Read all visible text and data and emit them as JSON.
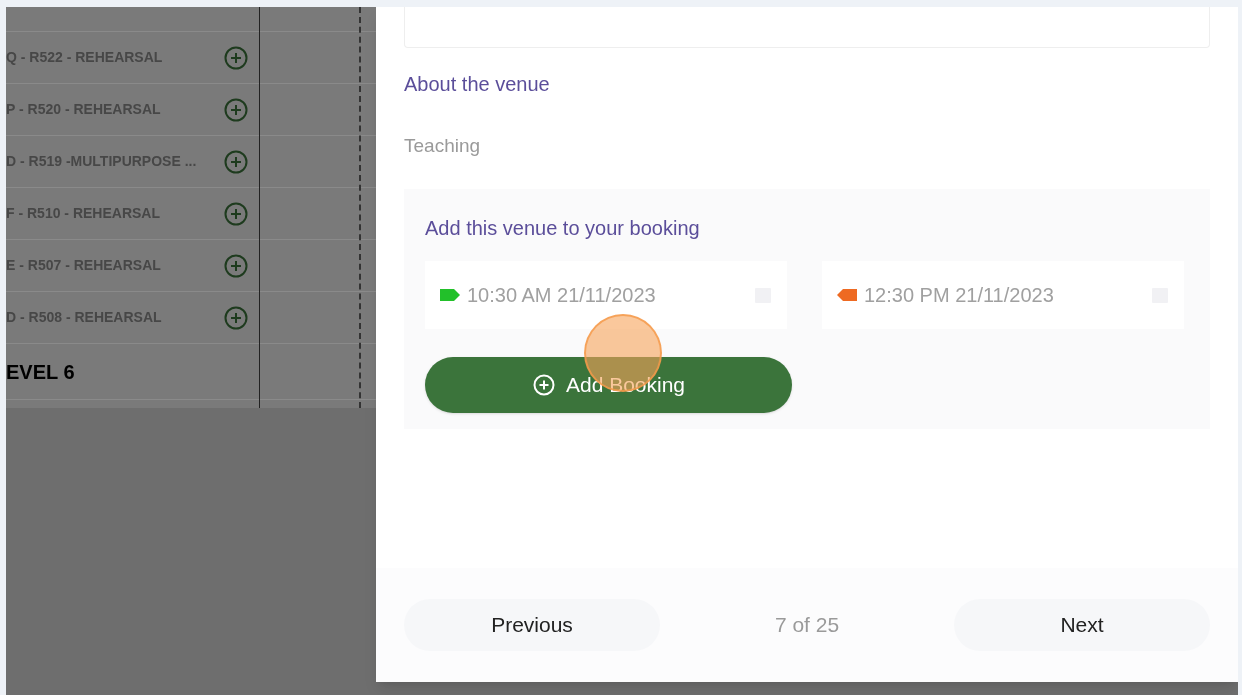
{
  "venue_list": {
    "rows": [
      {
        "label": "Q - R522 - REHEARSAL"
      },
      {
        "label": "P - R520 - REHEARSAL"
      },
      {
        "label": "D - R519 -MULTIPURPOSE ..."
      },
      {
        "label": "F - R510 - REHEARSAL"
      },
      {
        "label": "E - R507 - REHEARSAL"
      },
      {
        "label": "D - R508 - REHEARSAL"
      }
    ],
    "level_heading": "EVEL 6"
  },
  "venue_panel": {
    "about_heading": "About the venue",
    "description": "Teaching",
    "booking": {
      "title": "Add this venue to your booking",
      "times": [
        {
          "kind": "start",
          "color": "#22c02a",
          "value": "10:30 AM 21/11/2023"
        },
        {
          "kind": "end",
          "color": "#ee6a22",
          "value": "12:30 PM 21/11/2023"
        }
      ],
      "button": "Add Booking"
    }
  },
  "pagination": {
    "previous": "Previous",
    "position": "7 of 25",
    "next": "Next"
  }
}
